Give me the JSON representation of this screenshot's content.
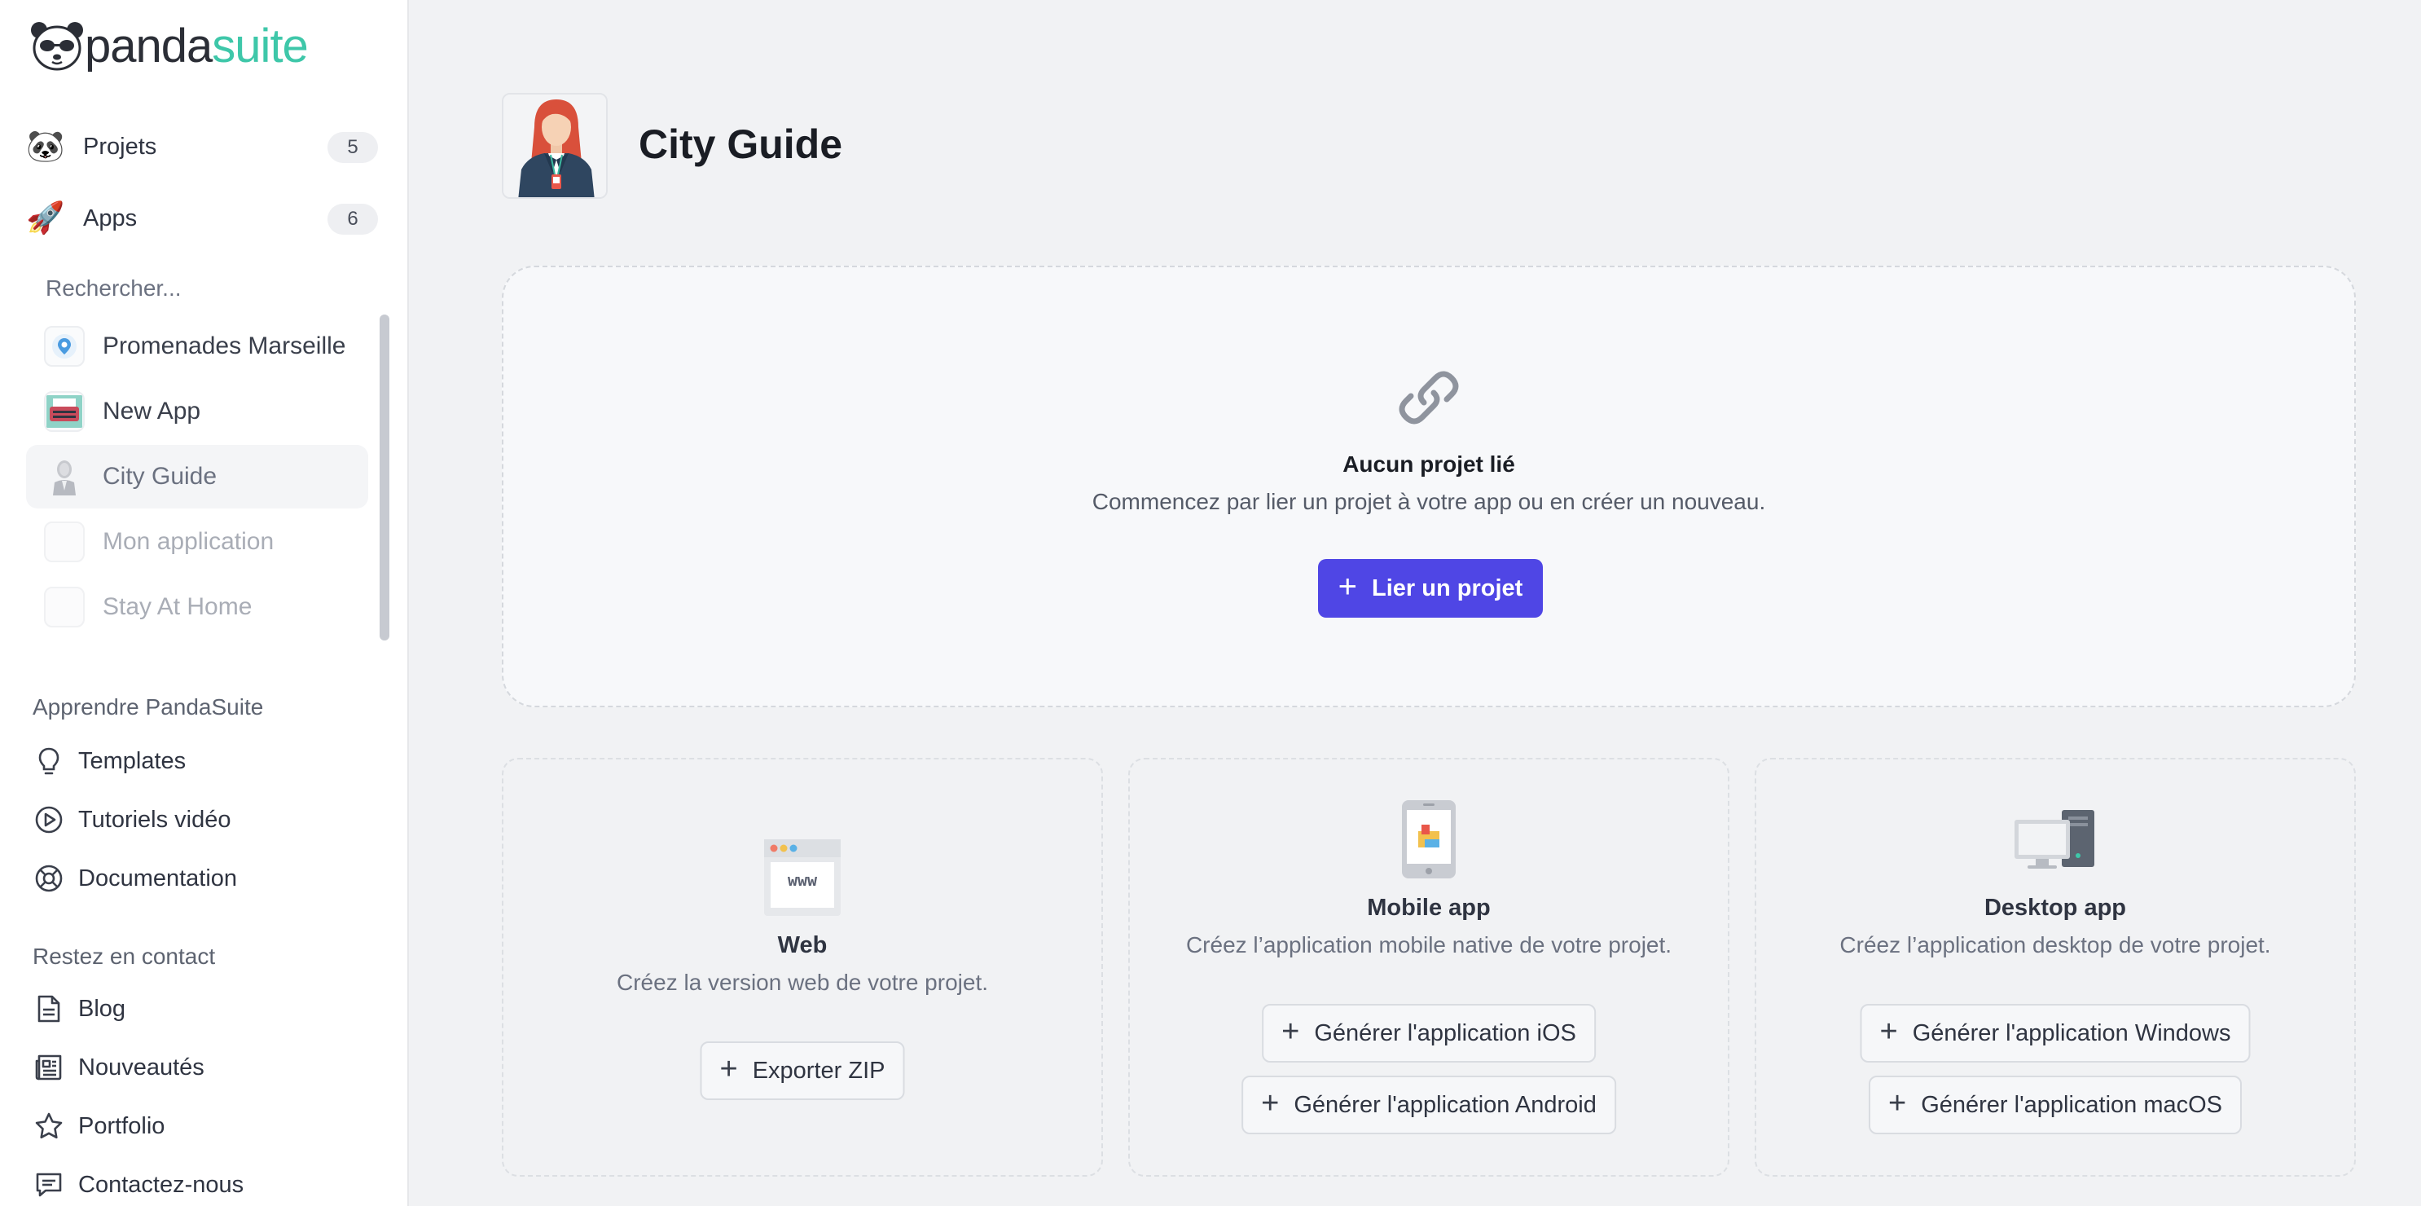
{
  "brand": {
    "logo_part1": "panda",
    "logo_part2": "suite"
  },
  "nav": [
    {
      "label": "Projets",
      "count": "5",
      "icon": "panda-icon"
    },
    {
      "label": "Apps",
      "count": "6",
      "icon": "rocket-icon"
    }
  ],
  "search": {
    "placeholder": "Rechercher..."
  },
  "apps": [
    {
      "name": "Promenades Marseille",
      "icon": "map-pin-icon"
    },
    {
      "name": "New App",
      "icon": "typewriter-icon"
    },
    {
      "name": "City Guide",
      "icon": "businesswoman-icon",
      "active": true
    },
    {
      "name": "Mon application",
      "icon": "blank-icon"
    },
    {
      "name": "Stay At Home",
      "icon": "blank-icon"
    }
  ],
  "learn": {
    "title": "Apprendre PandaSuite",
    "items": [
      {
        "label": "Templates",
        "icon": "lightbulb-icon"
      },
      {
        "label": "Tutoriels vidéo",
        "icon": "play-circle-icon"
      },
      {
        "label": "Documentation",
        "icon": "lifebuoy-icon"
      }
    ]
  },
  "contact": {
    "title": "Restez en contact",
    "items": [
      {
        "label": "Blog",
        "icon": "document-icon"
      },
      {
        "label": "Nouveautés",
        "icon": "newspaper-icon"
      },
      {
        "label": "Portfolio",
        "icon": "star-icon"
      },
      {
        "label": "Contactez-nous",
        "icon": "chat-icon"
      }
    ]
  },
  "page": {
    "title": "City Guide"
  },
  "empty_state": {
    "title": "Aucun projet lié",
    "subtitle": "Commencez par lier un projet à votre app ou en créer un nouveau.",
    "button": "Lier un projet",
    "icon": "link-icon"
  },
  "exports": [
    {
      "title": "Web",
      "subtitle": "Créez la version web de votre projet.",
      "icon": "browser-www-icon",
      "icon_text": "www",
      "buttons": [
        "Exporter ZIP"
      ]
    },
    {
      "title": "Mobile app",
      "subtitle": "Créez l’application mobile native de votre projet.",
      "icon": "smartphone-icon",
      "buttons": [
        "Générer l'application iOS",
        "Générer l'application Android"
      ]
    },
    {
      "title": "Desktop app",
      "subtitle": "Créez l’application desktop de votre projet.",
      "icon": "desktop-computer-icon",
      "buttons": [
        "Générer l'application Windows",
        "Générer l'application macOS"
      ]
    }
  ],
  "colors": {
    "primary": "#4f46e5",
    "brand_green": "#3ec7a9",
    "background": "#f1f2f4"
  }
}
